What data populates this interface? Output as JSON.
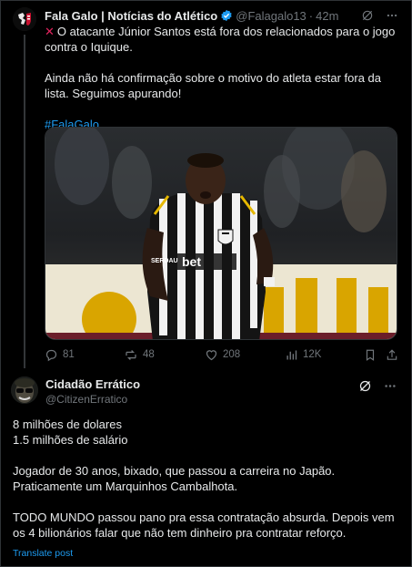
{
  "tweet": {
    "author_name": "Fala Galo | Notícias do Atlético",
    "handle": "@Falagalo13",
    "separator": "·",
    "time": "42m",
    "text_line1": "O atacante Júnior Santos está fora dos relacionados para o jogo contra o Iquique.",
    "text_line2": "Ainda não há confirmação sobre o motivo do atleta estar fora da lista. Seguimos apurando!",
    "hashtag": "#FalaGalo",
    "icons": [
      "verified-badge-icon",
      "grok-icon",
      "more-icon",
      "x-mark-icon"
    ],
    "media_description_words": {
      "jersey_sponsor": "bet",
      "jersey_sponsor_2": "SERDAU"
    },
    "actions": {
      "replies": "81",
      "reposts": "48",
      "likes": "208",
      "views": "12K"
    },
    "action_icons": [
      "reply-icon",
      "repost-icon",
      "like-icon",
      "views-icon",
      "bookmark-icon",
      "share-icon"
    ]
  },
  "reply": {
    "author_name": "Cidadão Errático",
    "handle": "@CitizenErratico",
    "lines_block1": [
      "8 milhões de dolares",
      "1.5 milhões de salário"
    ],
    "lines_block2": [
      "Jogador de 30 anos, bixado, que passou a carreira no Japão. Praticamente um Marquinhos Cambalhota."
    ],
    "lines_block3": [
      "TODO MUNDO passou pano pra essa contratação absurda. Depois vem os 4 bilionários falar que não tem dinheiro pra contratar reforço."
    ],
    "translate_label": "Translate post",
    "icons": [
      "grok-icon",
      "more-icon"
    ]
  },
  "colors": {
    "background": "#000000",
    "text": "#e7e9ea",
    "muted": "#71767b",
    "link": "#1d9bf0",
    "divider": "#2f3336",
    "x_mark": "#e0245e"
  }
}
